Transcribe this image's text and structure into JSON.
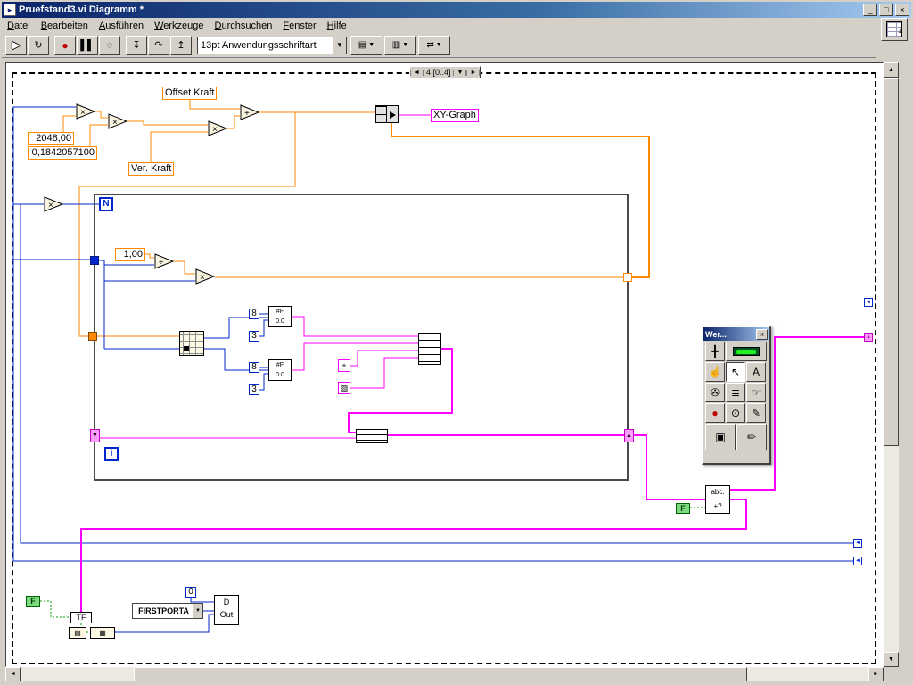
{
  "window": {
    "title": "Pruefstand3.vi Diagramm *",
    "app_icon": "▸",
    "minimize": "_",
    "maximize": "□",
    "close": "×",
    "vi_icon_num": "1"
  },
  "menu": {
    "items": [
      "Datei",
      "Bearbeiten",
      "Ausführen",
      "Werkzeuge",
      "Durchsuchen",
      "Fenster",
      "Hilfe"
    ]
  },
  "toolbar": {
    "font": "13pt Anwendungsschriftart",
    "run": "▶",
    "run_cont": "↻",
    "abort": "●",
    "pause": "▌▌",
    "bulb": "◌",
    "step_into": "↧",
    "step_over": "↷",
    "step_out": "↥",
    "align": "▤",
    "distribute": "▥",
    "reorder": "⇄",
    "dropdown": "▼"
  },
  "sequence": {
    "prev": "◄",
    "label": "4 [0..4]",
    "menu": "▼",
    "next": "►"
  },
  "diagram": {
    "offset_kraft": "Offset Kraft",
    "ver_kraft": "Ver. Kraft",
    "xy_graph": "XY-Graph",
    "c2048": "2048,00",
    "c0184": "0,1842057100",
    "c1": "1,00",
    "c8": "8",
    "c3": "3",
    "c0": "0",
    "n": "N",
    "i": "i",
    "mult": "×",
    "div": "÷",
    "add": "+",
    "fmt_top": "#F",
    "fmt_bot": "0.0",
    "p1": "+",
    "p2": "▨",
    "firstporta": "FIRSTPORTA",
    "dout_d": "D",
    "dout_out": "Out",
    "tf": "TF",
    "icon_barr": "▤",
    "icon_num": "▦",
    "abc": "abc.",
    "abc_sub": "+?",
    "f": "F",
    "sr_down": "▼",
    "sr_up": "▲",
    "local_left": "◄"
  },
  "palette": {
    "title": "Wer...",
    "close": "×",
    "auto": "╋",
    "operate": "☝",
    "position": "↖",
    "label": "A",
    "wire": "✇",
    "menu_tool": "≣",
    "scroll": "☞",
    "breakpoint": "●",
    "probe": "⊙",
    "copy_color": "✎",
    "color": "▣",
    "brush": "✏"
  },
  "scroll": {
    "up": "▲",
    "down": "▼",
    "left": "◄",
    "right": "►"
  }
}
